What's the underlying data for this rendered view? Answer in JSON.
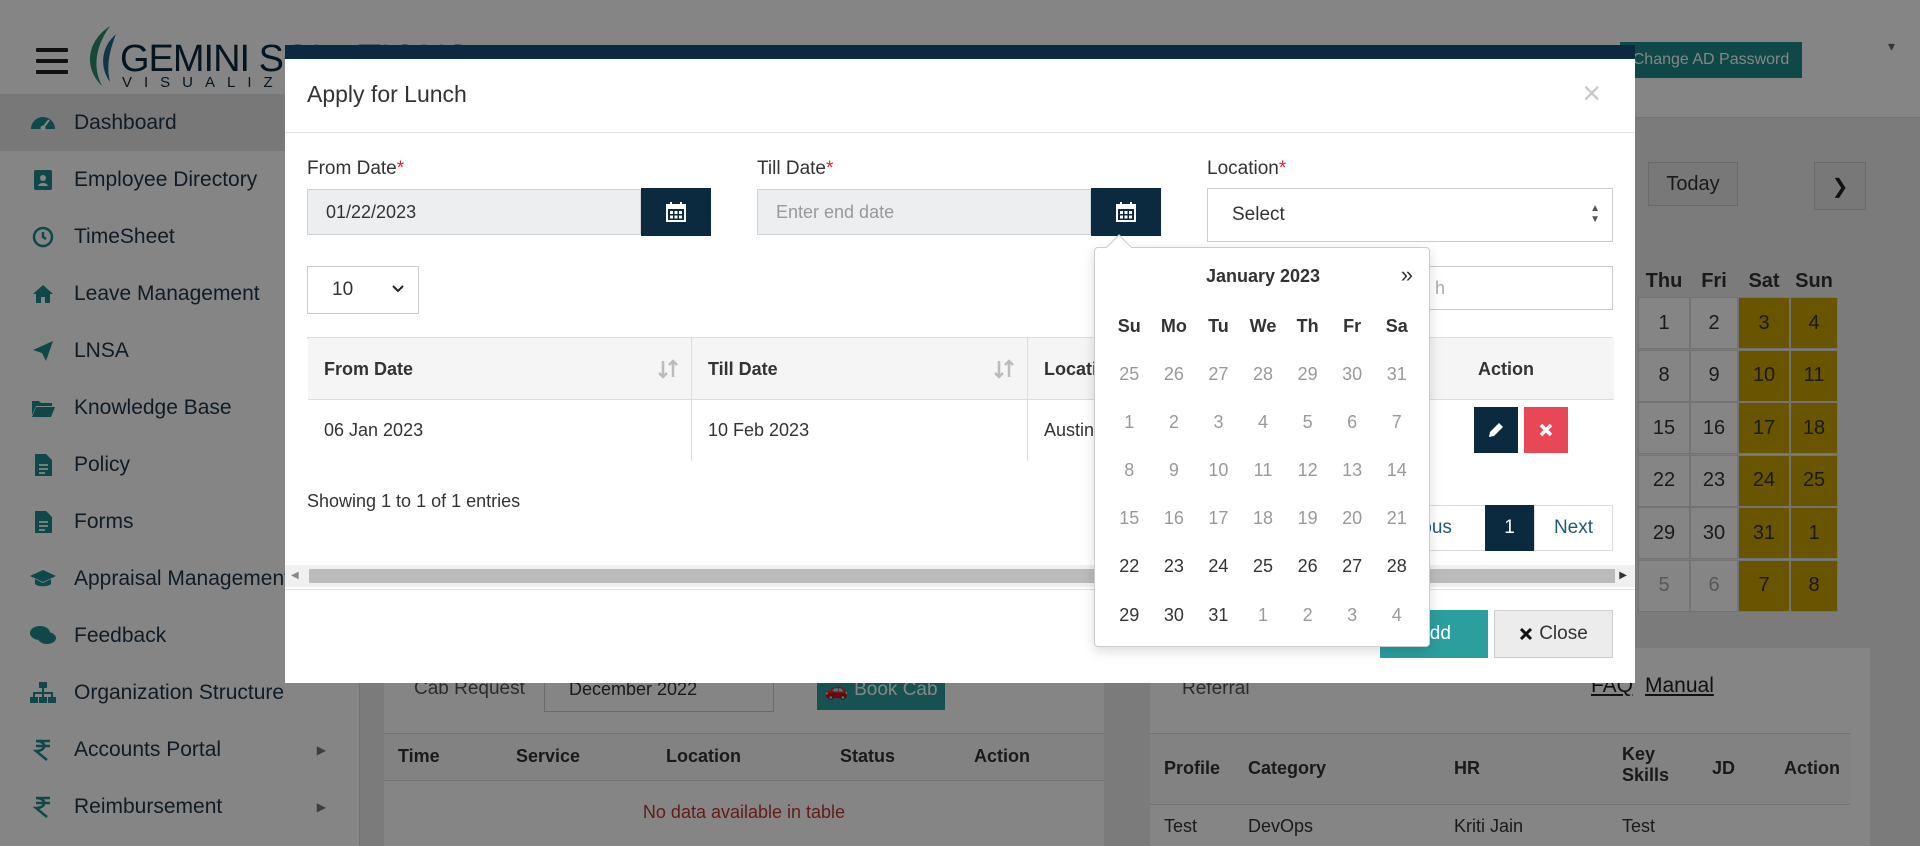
{
  "header": {
    "logo_text": "GEMINI SOLUTIONS",
    "logo_sub": "VISUALIZE",
    "change_password_label": "Change AD Password"
  },
  "sidebar": {
    "items": [
      {
        "label": "Dashboard",
        "icon": "dashboard-icon",
        "active": true
      },
      {
        "label": "Employee Directory",
        "icon": "directory-icon"
      },
      {
        "label": "TimeSheet",
        "icon": "clock-icon"
      },
      {
        "label": "Leave Management",
        "icon": "home-icon"
      },
      {
        "label": "LNSA",
        "icon": "paper-plane-icon"
      },
      {
        "label": "Knowledge Base",
        "icon": "folder-open-icon"
      },
      {
        "label": "Policy",
        "icon": "document-icon"
      },
      {
        "label": "Forms",
        "icon": "document-icon"
      },
      {
        "label": "Appraisal Management",
        "icon": "graduation-cap-icon"
      },
      {
        "label": "Feedback",
        "icon": "comments-icon"
      },
      {
        "label": "Organization Structure",
        "icon": "sitemap-icon"
      },
      {
        "label": "Accounts Portal",
        "icon": "rupee-icon",
        "has_submenu": true
      },
      {
        "label": "Reimbursement",
        "icon": "rupee-icon",
        "has_submenu": true
      }
    ]
  },
  "background": {
    "calendar": {
      "today_label": "Today",
      "next_label": "❯",
      "days": [
        "Thu",
        "Fri",
        "Sat",
        "Sun"
      ],
      "rows": [
        [
          "1",
          "2",
          "3",
          "4"
        ],
        [
          "8",
          "9",
          "10",
          "11"
        ],
        [
          "15",
          "16",
          "17",
          "18"
        ],
        [
          "22",
          "23",
          "24",
          "25"
        ],
        [
          "29",
          "30",
          "31",
          "1"
        ],
        [
          "5",
          "6",
          "7",
          "8"
        ]
      ]
    },
    "cab": {
      "title": "Cab Request",
      "month": "December 2022",
      "book_label": "Book Cab",
      "columns": [
        "Time",
        "Service",
        "Location",
        "Status",
        "Action"
      ],
      "empty": "No data available in table"
    },
    "referral": {
      "title": "Referral",
      "faq": "FAQ",
      "manual": "Manual",
      "columns": [
        "Profile",
        "Category",
        "HR",
        "Key Skills",
        "JD",
        "Action"
      ],
      "row": [
        "Test",
        "DevOps",
        "Kriti Jain",
        "Test"
      ]
    }
  },
  "modal": {
    "title": "Apply for Lunch",
    "close_x": "×",
    "from_date_label": "From Date",
    "from_date_value": "01/22/2023",
    "till_date_label": "Till Date",
    "till_date_placeholder": "Enter end date",
    "location_label": "Location",
    "location_value": "Select",
    "required_mark": "*",
    "page_length": "10",
    "search_partial": "h",
    "table": {
      "columns": [
        "From Date",
        "Till Date",
        "Locati",
        "Action"
      ],
      "rows": [
        {
          "from": "06 Jan 2023",
          "till": "10 Feb 2023",
          "location": "Austin"
        }
      ]
    },
    "showing_text": "Showing 1 to 1 of 1 entries",
    "pager": {
      "previous": "ious",
      "current": "1",
      "next": "Next"
    },
    "add_label": "Add",
    "close_label": "Close"
  },
  "datepicker": {
    "title": "January 2023",
    "next": "»",
    "dow": [
      "Su",
      "Mo",
      "Tu",
      "We",
      "Th",
      "Fr",
      "Sa"
    ],
    "weeks": [
      [
        "25",
        "26",
        "27",
        "28",
        "29",
        "30",
        "31"
      ],
      [
        "1",
        "2",
        "3",
        "4",
        "5",
        "6",
        "7"
      ],
      [
        "8",
        "9",
        "10",
        "11",
        "12",
        "13",
        "14"
      ],
      [
        "15",
        "16",
        "17",
        "18",
        "19",
        "20",
        "21"
      ],
      [
        "22",
        "23",
        "24",
        "25",
        "26",
        "27",
        "28"
      ],
      [
        "29",
        "30",
        "31",
        "1",
        "2",
        "3",
        "4"
      ]
    ],
    "disabled_weeks": [
      true,
      true,
      true,
      true,
      false,
      false
    ],
    "next_month_tail_start": 3
  },
  "colors": {
    "navy": "#0b2a3f",
    "teal": "#2b9e9e",
    "danger": "#e84855",
    "weekend": "#c9a300"
  }
}
